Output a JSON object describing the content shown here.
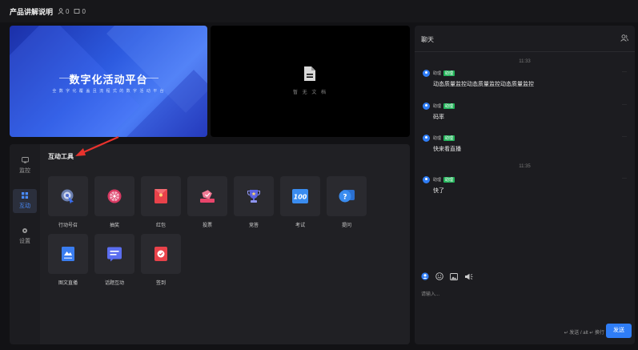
{
  "topbar": {
    "title": "产品讲解说明",
    "viewers": "0",
    "docs": "0"
  },
  "slide": {
    "title": "数字化活动平台",
    "subtitle": "全 数 字 化 覆 盖 且 流 程 式 的 数 字 活 动 平 台"
  },
  "doc": {
    "empty_text": "暂 无 文 档"
  },
  "nav": {
    "items": [
      {
        "label": "监控",
        "icon": "monitor-icon"
      },
      {
        "label": "互动",
        "icon": "grid-icon",
        "active": true
      },
      {
        "label": "设置",
        "icon": "gear-icon"
      }
    ]
  },
  "tools": {
    "heading": "互动工具",
    "items": [
      {
        "label": "行动号召",
        "icon": "target-icon",
        "color": "#5a7bd9"
      },
      {
        "label": "抽奖",
        "icon": "lottery-wheel-icon",
        "color": "#e8456b"
      },
      {
        "label": "红包",
        "icon": "red-envelope-icon",
        "color": "#e8424a"
      },
      {
        "label": "投票",
        "icon": "vote-icon",
        "color": "#e8456b"
      },
      {
        "label": "竞答",
        "icon": "trophy-icon",
        "color": "#5b63e0"
      },
      {
        "label": "考试",
        "icon": "exam-icon",
        "color": "#3a8cf0"
      },
      {
        "label": "提问",
        "icon": "question-icon",
        "color": "#3a8cf0"
      },
      {
        "label": "图文直播",
        "icon": "image-text-icon",
        "color": "#3a7df0"
      },
      {
        "label": "话题互动",
        "icon": "topic-icon",
        "color": "#5b6ef0"
      },
      {
        "label": "签到",
        "icon": "checkin-icon",
        "color": "#e8424a"
      }
    ]
  },
  "chat": {
    "title": "聊天",
    "times": [
      "11:33",
      "11:35"
    ],
    "messages": [
      {
        "name": "助理",
        "tag": "助理",
        "text": "动态质量监控动态质量监控动态质量监控"
      },
      {
        "name": "助理",
        "tag": "助理",
        "text": "码率"
      },
      {
        "name": "助理",
        "tag": "助理",
        "text": "快来看直播"
      },
      {
        "name": "助理",
        "tag": "助理",
        "text": "快了"
      }
    ],
    "more": "···",
    "placeholder": "请输入...",
    "hint": "↵ 发送 / alt ↵ 换行",
    "send_label": "发送"
  },
  "colors": {
    "accent": "#2f7df6",
    "tag": "#23b45a",
    "arrow": "#e8322d"
  }
}
